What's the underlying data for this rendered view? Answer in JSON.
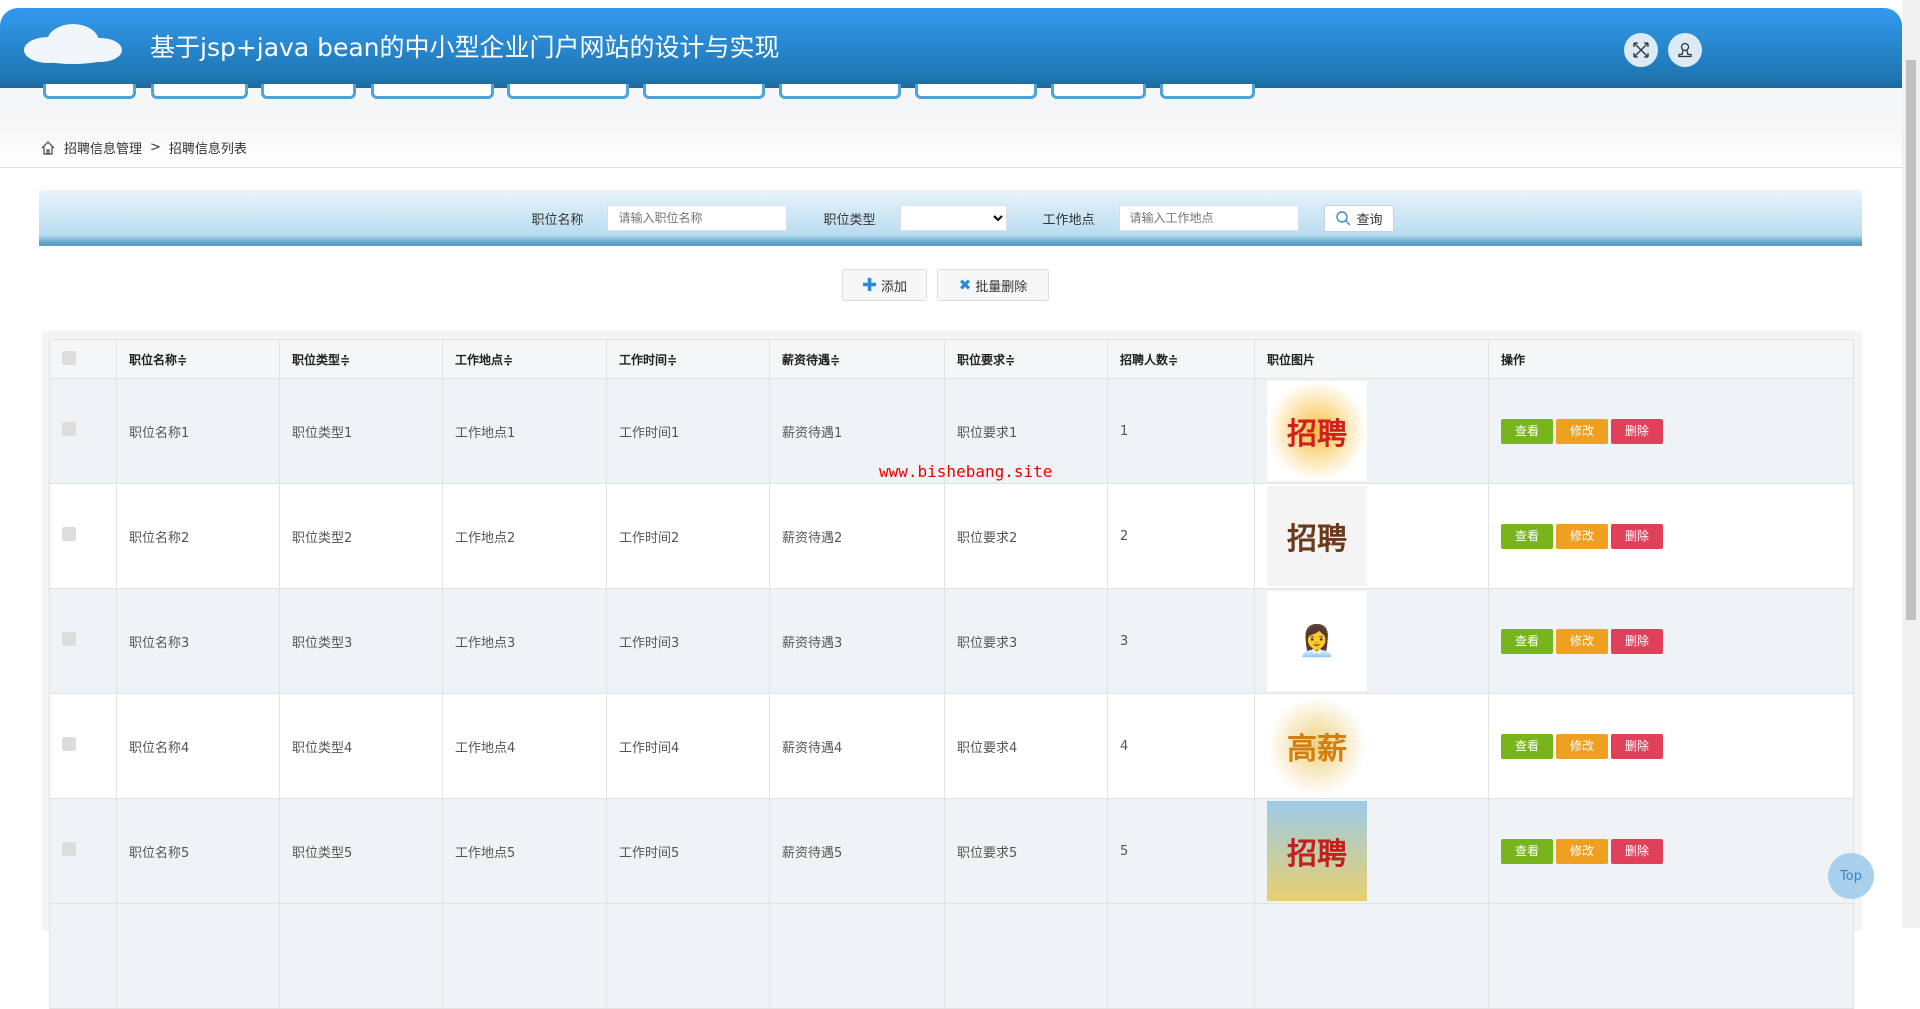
{
  "header": {
    "title": "基于jsp+java bean的中小型企业门户网站的设计与实现",
    "icons": [
      "fullscreen-icon",
      "user-icon"
    ]
  },
  "breadcrumb": {
    "items": [
      "招聘信息管理",
      "招聘信息列表"
    ],
    "separator": ">"
  },
  "search": {
    "name_label": "职位名称",
    "name_placeholder": "请输入职位名称",
    "type_label": "职位类型",
    "type_value": "",
    "location_label": "工作地点",
    "location_placeholder": "请输入工作地点",
    "query_label": "查询"
  },
  "toolbar": {
    "add_label": "添加",
    "batch_delete_label": "批量删除"
  },
  "table": {
    "headers": [
      "职位名称",
      "职位类型",
      "工作地点",
      "工作时间",
      "薪资待遇",
      "职位要求",
      "招聘人数",
      "职位图片",
      "操作"
    ],
    "actions": {
      "view": "查看",
      "edit": "修改",
      "delete": "删除"
    },
    "rows": [
      {
        "name": "职位名称1",
        "type": "职位类型1",
        "location": "工作地点1",
        "time": "工作时间1",
        "salary": "薪资待遇1",
        "req": "职位要求1",
        "count": "1"
      },
      {
        "name": "职位名称2",
        "type": "职位类型2",
        "location": "工作地点2",
        "time": "工作时间2",
        "salary": "薪资待遇2",
        "req": "职位要求2",
        "count": "2"
      },
      {
        "name": "职位名称3",
        "type": "职位类型3",
        "location": "工作地点3",
        "time": "工作时间3",
        "salary": "薪资待遇3",
        "req": "职位要求3",
        "count": "3"
      },
      {
        "name": "职位名称4",
        "type": "职位类型4",
        "location": "工作地点4",
        "time": "工作时间4",
        "salary": "薪资待遇4",
        "req": "职位要求4",
        "count": "4"
      },
      {
        "name": "职位名称5",
        "type": "职位类型5",
        "location": "工作地点5",
        "time": "工作时间5",
        "salary": "薪资待遇5",
        "req": "职位要求5",
        "count": "5"
      }
    ]
  },
  "watermark": "www.bishebang.site",
  "top_button": "Top",
  "colors": {
    "header": "#2a86d0",
    "view": "#78b51c",
    "edit": "#f0a020",
    "delete": "#e0405a"
  }
}
